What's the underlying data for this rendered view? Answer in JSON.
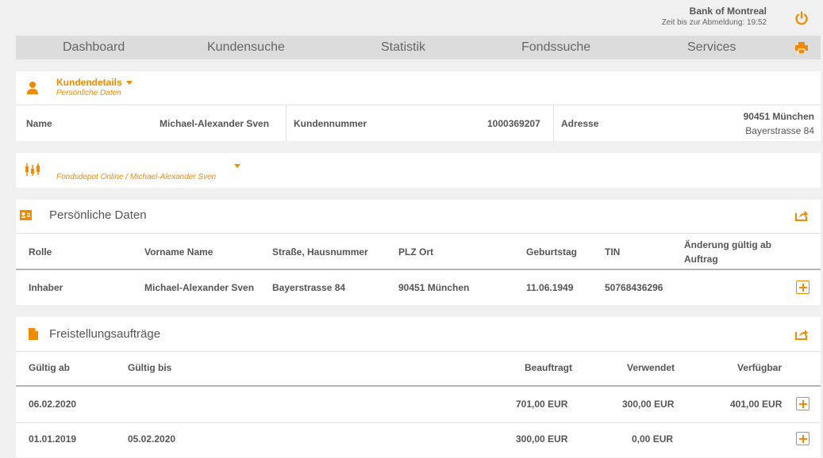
{
  "header": {
    "bank_name": "Bank of Montreal",
    "session_timer": "Zeit bis zur Abmeldung: 19:52",
    "accent_color": "#f08a00"
  },
  "nav": {
    "items": [
      "Dashboard",
      "Kundensuche",
      "Statistik",
      "Fondssuche",
      "Services"
    ]
  },
  "kunde": {
    "title": "Kundendetails",
    "subtitle": "Persönliche Daten",
    "name_label": "Name",
    "name_value": "Michael-Alexander Sven",
    "kundennummer_label": "Kundennummer",
    "kundennummer_value": "1000369207",
    "adresse_label": "Adresse",
    "adresse_line1": "90451 München",
    "adresse_line2": "Bayerstrasse 84"
  },
  "depot": {
    "selector": "Fondsdepot Online / Michael-Alexander Sven"
  },
  "persoenlich": {
    "title": "Persönliche Daten",
    "headers": {
      "rolle": "Rolle",
      "vorname": "Vorname Name",
      "strasse": "Straße, Hausnummer",
      "plz": "PLZ Ort",
      "geburtstag": "Geburtstag",
      "tin": "TIN",
      "aenderung_1": "Änderung gültig ab",
      "aenderung_2": "Auftrag"
    },
    "row": {
      "rolle": "Inhaber",
      "vorname": "Michael-Alexander Sven",
      "strasse": "Bayerstrasse 84",
      "plz": "90451 München",
      "geburtstag": "11.06.1949",
      "tin": "50768436296"
    }
  },
  "freistellung": {
    "title": "Freistellungsaufträge",
    "headers": {
      "gueltig_ab": "Gültig ab",
      "gueltig_bis": "Gültig bis",
      "beauftragt": "Beauftragt",
      "verwendet": "Verwendet",
      "verfuegbar": "Verfügbar"
    },
    "rows": [
      {
        "gueltig_ab": "06.02.2020",
        "gueltig_bis": "",
        "beauftragt": "701,00 EUR",
        "verwendet": "300,00 EUR",
        "verfuegbar": "401,00 EUR"
      },
      {
        "gueltig_ab": "01.01.2019",
        "gueltig_bis": "05.02.2020",
        "beauftragt": "300,00 EUR",
        "verwendet": "0,00 EUR",
        "verfuegbar": ""
      }
    ]
  }
}
